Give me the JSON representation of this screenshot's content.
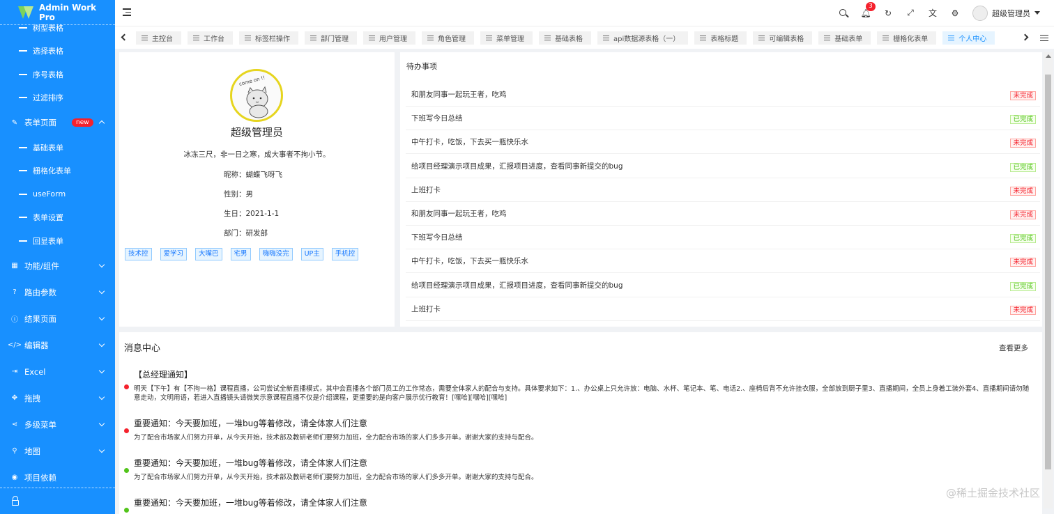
{
  "app": {
    "title": "Admin Work Pro"
  },
  "sidebar": {
    "sub_items_top": [
      "树型表格",
      "选择表格",
      "序号表格",
      "过滤排序"
    ],
    "form_group": {
      "label": "表单页面",
      "badge": "new"
    },
    "form_items": [
      "基础表单",
      "栅格化表单",
      "useForm",
      "表单设置",
      "回显表单"
    ],
    "groups": [
      "功能/组件",
      "路由参数",
      "结果页面",
      "编辑器",
      "Excel",
      "拖拽",
      "多级菜单",
      "地图"
    ],
    "project_deps": "项目依赖"
  },
  "header": {
    "notification_count": "3",
    "username": "超级管理员"
  },
  "tabs": [
    "主控台",
    "工作台",
    "标签栏操作",
    "部门管理",
    "用户管理",
    "角色管理",
    "菜单管理",
    "基础表格",
    "api数据源表格（一）",
    "表格标题",
    "可编辑表格",
    "基础表单",
    "栅格化表单",
    "个人中心"
  ],
  "profile": {
    "name": "超级管理员",
    "motto": "冰冻三尺，非一日之寒，成大事者不拘小节。",
    "nickname": "昵称：蝴蝶飞呀飞",
    "gender": "性别：男",
    "birthday": "生日：2021-1-1",
    "department": "部门：研发部",
    "tags": [
      "技术控",
      "爱学习",
      "大嘴巴",
      "宅男",
      "嗨嗨没完",
      "UP主",
      "手机控"
    ],
    "avatar_text": "come on !!"
  },
  "todo": {
    "title": "待办事项",
    "items": [
      {
        "text": "和朋友同事一起玩王者，吃鸡",
        "status": "未完成",
        "done": false
      },
      {
        "text": "下班写今日总结",
        "status": "已完成",
        "done": true
      },
      {
        "text": "中午打卡，吃饭，下去买一瓶快乐水",
        "status": "未完成",
        "done": false
      },
      {
        "text": "给项目经理演示项目成果，汇报项目进度，查看同事新提交的bug",
        "status": "已完成",
        "done": true
      },
      {
        "text": "上班打卡",
        "status": "未完成",
        "done": false
      },
      {
        "text": "和朋友同事一起玩王者，吃鸡",
        "status": "未完成",
        "done": false
      },
      {
        "text": "下班写今日总结",
        "status": "已完成",
        "done": true
      },
      {
        "text": "中午打卡，吃饭，下去买一瓶快乐水",
        "status": "未完成",
        "done": false
      },
      {
        "text": "给项目经理演示项目成果，汇报项目进度，查看同事新提交的bug",
        "status": "已完成",
        "done": true
      },
      {
        "text": "上班打卡",
        "status": "未完成",
        "done": false
      }
    ]
  },
  "messages": {
    "title": "消息中心",
    "more": "查看更多",
    "items": [
      {
        "title": "【总经理通知】",
        "body": "明天【下午】有【不拘一格】课程直播，公司尝试全新直播模式，其中会直播各个部门员工的工作常态，需要全体家人的配合与支持。具体要求如下：1.、办公桌上只允许放：电脑、水杯、笔记本、笔、电话2.、座椅后背不允许挂衣服，全部放到厨子里3、直播期间，全员上身着工装外套4、直播期间请勿随意走动，文明用语，若进入直播镜头请微笑示意课程直播不仅是介绍课程，更重要的是向客户展示优行教育！[嘿哈][嘿哈][嘿哈]",
        "dot_color": "#f5222d"
      },
      {
        "title": "重要通知：今天要加班，一堆bug等着修改，请全体家人们注意",
        "body": "为了配合市场家人们努力开单，从今天开始，技术部及教研老师们要努力加班，全力配合市场的家人们多多开单。谢谢大家的支持与配合。",
        "dot_color": "#f5222d"
      },
      {
        "title": "重要通知：今天要加班，一堆bug等着修改，请全体家人们注意",
        "body": "为了配合市场家人们努力开单，从今天开始，技术部及教研老师们要努力加班，全力配合市场的家人们多多开单。谢谢大家的支持与配合。",
        "dot_color": "#52c41a"
      },
      {
        "title": "重要通知：今天要加班，一堆bug等着修改，请全体家人们注意",
        "body": "",
        "dot_color": "#52c41a"
      }
    ]
  },
  "watermark": "@稀土掘金技术社区"
}
